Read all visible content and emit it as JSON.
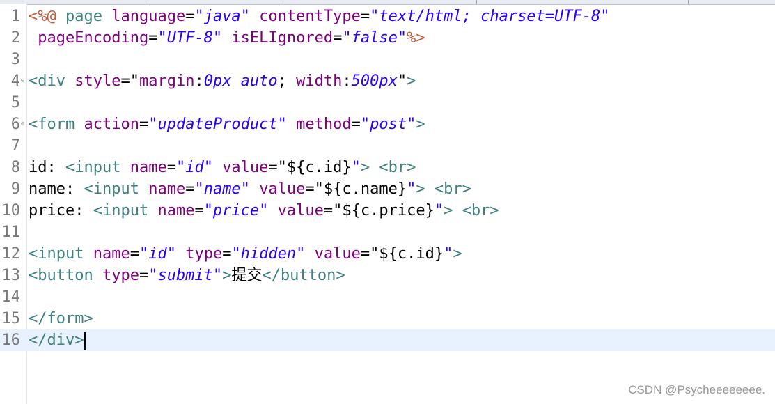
{
  "editor": {
    "lines": [
      {
        "num": "1",
        "fold": "",
        "tokens": [
          {
            "t": "<%@",
            "c": "jsp"
          },
          {
            "t": " "
          },
          {
            "t": "page",
            "c": "tag"
          },
          {
            "t": " "
          },
          {
            "t": "language",
            "c": "attr"
          },
          {
            "t": "=",
            "c": "txt"
          },
          {
            "t": "\"java\"",
            "c": "val"
          },
          {
            "t": " "
          },
          {
            "t": "contentType",
            "c": "attr"
          },
          {
            "t": "=",
            "c": "txt"
          },
          {
            "t": "\"text/html; charset=UTF-8\"",
            "c": "val"
          }
        ]
      },
      {
        "num": "2",
        "fold": "",
        "tokens": [
          {
            "t": " "
          },
          {
            "t": "pageEncoding",
            "c": "attr"
          },
          {
            "t": "=",
            "c": "txt"
          },
          {
            "t": "\"UTF-8\"",
            "c": "val"
          },
          {
            "t": " "
          },
          {
            "t": "isELIgnored",
            "c": "attr"
          },
          {
            "t": "=",
            "c": "txt"
          },
          {
            "t": "\"false\"",
            "c": "val"
          },
          {
            "t": "%>",
            "c": "jsp"
          }
        ]
      },
      {
        "num": "3",
        "fold": "",
        "tokens": []
      },
      {
        "num": "4",
        "fold": "⊖",
        "tokens": [
          {
            "t": "<div",
            "c": "tag"
          },
          {
            "t": " "
          },
          {
            "t": "style",
            "c": "attr"
          },
          {
            "t": "=\"",
            "c": "txt"
          },
          {
            "t": "margin",
            "c": "attr"
          },
          {
            "t": ":",
            "c": "txt"
          },
          {
            "t": "0px auto",
            "c": "val"
          },
          {
            "t": "; ",
            "c": "txt"
          },
          {
            "t": "width",
            "c": "attr"
          },
          {
            "t": ":",
            "c": "txt"
          },
          {
            "t": "500px",
            "c": "val"
          },
          {
            "t": "\"",
            "c": "txt"
          },
          {
            "t": ">",
            "c": "tag"
          }
        ]
      },
      {
        "num": "5",
        "fold": "",
        "tokens": []
      },
      {
        "num": "6",
        "fold": "⊖",
        "tokens": [
          {
            "t": "<form",
            "c": "tag"
          },
          {
            "t": " "
          },
          {
            "t": "action",
            "c": "attr"
          },
          {
            "t": "=",
            "c": "txt"
          },
          {
            "t": "\"updateProduct\"",
            "c": "val"
          },
          {
            "t": " "
          },
          {
            "t": "method",
            "c": "attr"
          },
          {
            "t": "=",
            "c": "txt"
          },
          {
            "t": "\"post\"",
            "c": "val"
          },
          {
            "t": ">",
            "c": "tag"
          }
        ]
      },
      {
        "num": "7",
        "fold": "",
        "tokens": []
      },
      {
        "num": "8",
        "fold": "",
        "tokens": [
          {
            "t": "id: ",
            "c": "txt"
          },
          {
            "t": "<input",
            "c": "tag"
          },
          {
            "t": " "
          },
          {
            "t": "name",
            "c": "attr"
          },
          {
            "t": "=",
            "c": "txt"
          },
          {
            "t": "\"id\"",
            "c": "val"
          },
          {
            "t": " "
          },
          {
            "t": "value",
            "c": "attr"
          },
          {
            "t": "=\"${c.id}",
            "c": "txt"
          },
          {
            "t": "\"",
            "c": "val"
          },
          {
            "t": ">",
            "c": "tag"
          },
          {
            "t": " "
          },
          {
            "t": "<br>",
            "c": "tag"
          }
        ]
      },
      {
        "num": "9",
        "fold": "",
        "tokens": [
          {
            "t": "name: ",
            "c": "txt"
          },
          {
            "t": "<input",
            "c": "tag"
          },
          {
            "t": " "
          },
          {
            "t": "name",
            "c": "attr"
          },
          {
            "t": "=",
            "c": "txt"
          },
          {
            "t": "\"name\"",
            "c": "val"
          },
          {
            "t": " "
          },
          {
            "t": "value",
            "c": "attr"
          },
          {
            "t": "=\"${c.name}",
            "c": "txt"
          },
          {
            "t": "\"",
            "c": "val"
          },
          {
            "t": ">",
            "c": "tag"
          },
          {
            "t": " "
          },
          {
            "t": "<br>",
            "c": "tag"
          }
        ]
      },
      {
        "num": "10",
        "fold": "",
        "tokens": [
          {
            "t": "price: ",
            "c": "txt"
          },
          {
            "t": "<input",
            "c": "tag"
          },
          {
            "t": " "
          },
          {
            "t": "name",
            "c": "attr"
          },
          {
            "t": "=",
            "c": "txt"
          },
          {
            "t": "\"price\"",
            "c": "val"
          },
          {
            "t": " "
          },
          {
            "t": "value",
            "c": "attr"
          },
          {
            "t": "=\"${c.price}",
            "c": "txt"
          },
          {
            "t": "\"",
            "c": "val"
          },
          {
            "t": ">",
            "c": "tag"
          },
          {
            "t": " "
          },
          {
            "t": "<br>",
            "c": "tag"
          }
        ]
      },
      {
        "num": "11",
        "fold": "",
        "tokens": []
      },
      {
        "num": "12",
        "fold": "",
        "tokens": [
          {
            "t": "<input",
            "c": "tag"
          },
          {
            "t": " "
          },
          {
            "t": "name",
            "c": "attr"
          },
          {
            "t": "=",
            "c": "txt"
          },
          {
            "t": "\"id\"",
            "c": "val"
          },
          {
            "t": " "
          },
          {
            "t": "type",
            "c": "attr"
          },
          {
            "t": "=",
            "c": "txt"
          },
          {
            "t": "\"hidden\"",
            "c": "val"
          },
          {
            "t": " "
          },
          {
            "t": "value",
            "c": "attr"
          },
          {
            "t": "=\"${c.id}",
            "c": "txt"
          },
          {
            "t": "\"",
            "c": "val"
          },
          {
            "t": ">",
            "c": "tag"
          }
        ]
      },
      {
        "num": "13",
        "fold": "",
        "tokens": [
          {
            "t": "<button",
            "c": "tag"
          },
          {
            "t": " "
          },
          {
            "t": "type",
            "c": "attr"
          },
          {
            "t": "=",
            "c": "txt"
          },
          {
            "t": "\"submit\"",
            "c": "val"
          },
          {
            "t": ">",
            "c": "tag"
          },
          {
            "t": "提交",
            "c": "txt"
          },
          {
            "t": "</button>",
            "c": "tag"
          }
        ]
      },
      {
        "num": "14",
        "fold": "",
        "tokens": []
      },
      {
        "num": "15",
        "fold": "",
        "tokens": [
          {
            "t": "</form>",
            "c": "tag"
          }
        ]
      },
      {
        "num": "16",
        "fold": "",
        "current": true,
        "cursor": true,
        "tokens": [
          {
            "t": "</div>",
            "c": "tag"
          }
        ]
      }
    ]
  },
  "watermark": "CSDN @Psycheeeeeeee."
}
